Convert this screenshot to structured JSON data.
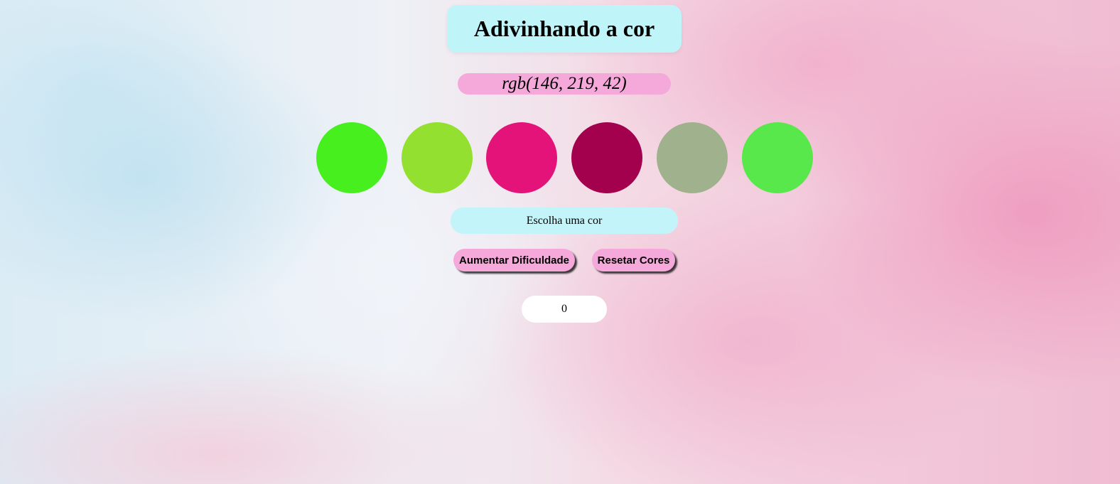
{
  "header": {
    "title": "Adivinhando a cor"
  },
  "rgb_target": "rgb(146, 219, 42)",
  "balls": [
    {
      "color": "#48ef1f"
    },
    {
      "color": "#93e030"
    },
    {
      "color": "#e3137a"
    },
    {
      "color": "#a3004e"
    },
    {
      "color": "#9fb18d"
    },
    {
      "color": "#59e84b"
    }
  ],
  "answer": "Escolha uma cor",
  "buttons": {
    "increase_difficulty": "Aumentar Dificuldade",
    "reset_colors": "Resetar Cores"
  },
  "score": "0"
}
